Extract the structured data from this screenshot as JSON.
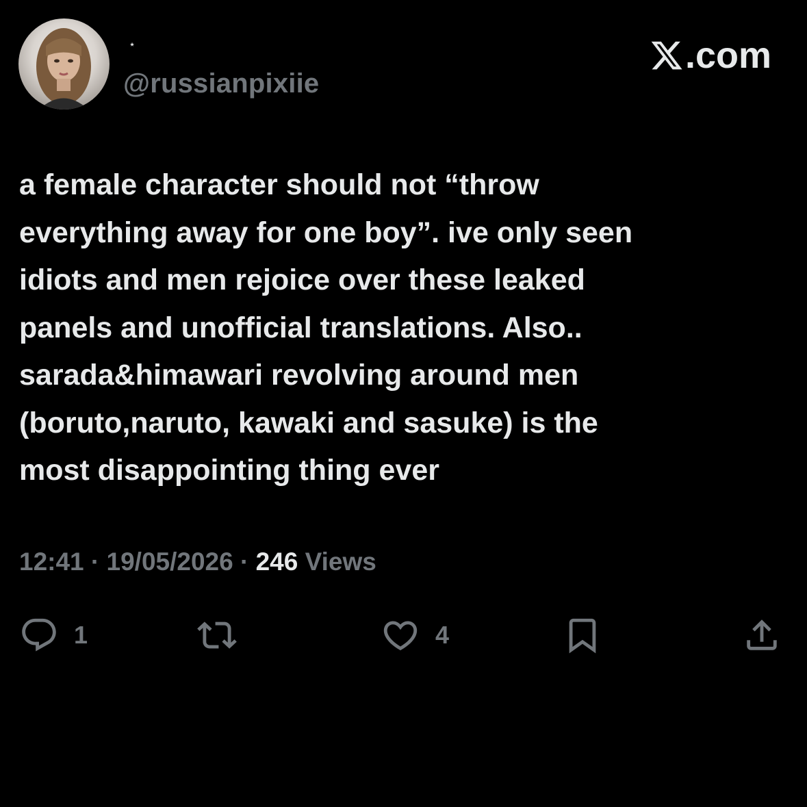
{
  "author": {
    "display_name": "⋆",
    "handle": "@russianpixiie",
    "avatar_icon": "profile-photo-avatar"
  },
  "brand": {
    "logo_icon": "x-logo-icon",
    "domain_suffix": ".com"
  },
  "tweet": {
    "lines": [
      "a female character should not “throw",
      "everything away for one boy”. ive only seen",
      "idiots and men rejoice over these leaked",
      "panels and unofficial translations. Also..",
      "sarada&himawari revolving around men",
      "(boruto,naruto, kawaki and sasuke) is the",
      "most disappointing thing ever"
    ]
  },
  "meta": {
    "time": "12:41",
    "separator": " · ",
    "date": "19/05/2026",
    "views_count": "246",
    "views_label": " Views"
  },
  "actions": {
    "reply": {
      "icon": "reply-icon",
      "count": "1"
    },
    "retweet": {
      "icon": "retweet-icon",
      "count": ""
    },
    "like": {
      "icon": "heart-icon",
      "count": "4"
    },
    "bookmark": {
      "icon": "bookmark-icon",
      "count": ""
    },
    "share": {
      "icon": "share-icon",
      "count": ""
    }
  },
  "colors": {
    "background": "#000000",
    "primary_text": "#e7e9ea",
    "secondary_text": "#71767b"
  }
}
